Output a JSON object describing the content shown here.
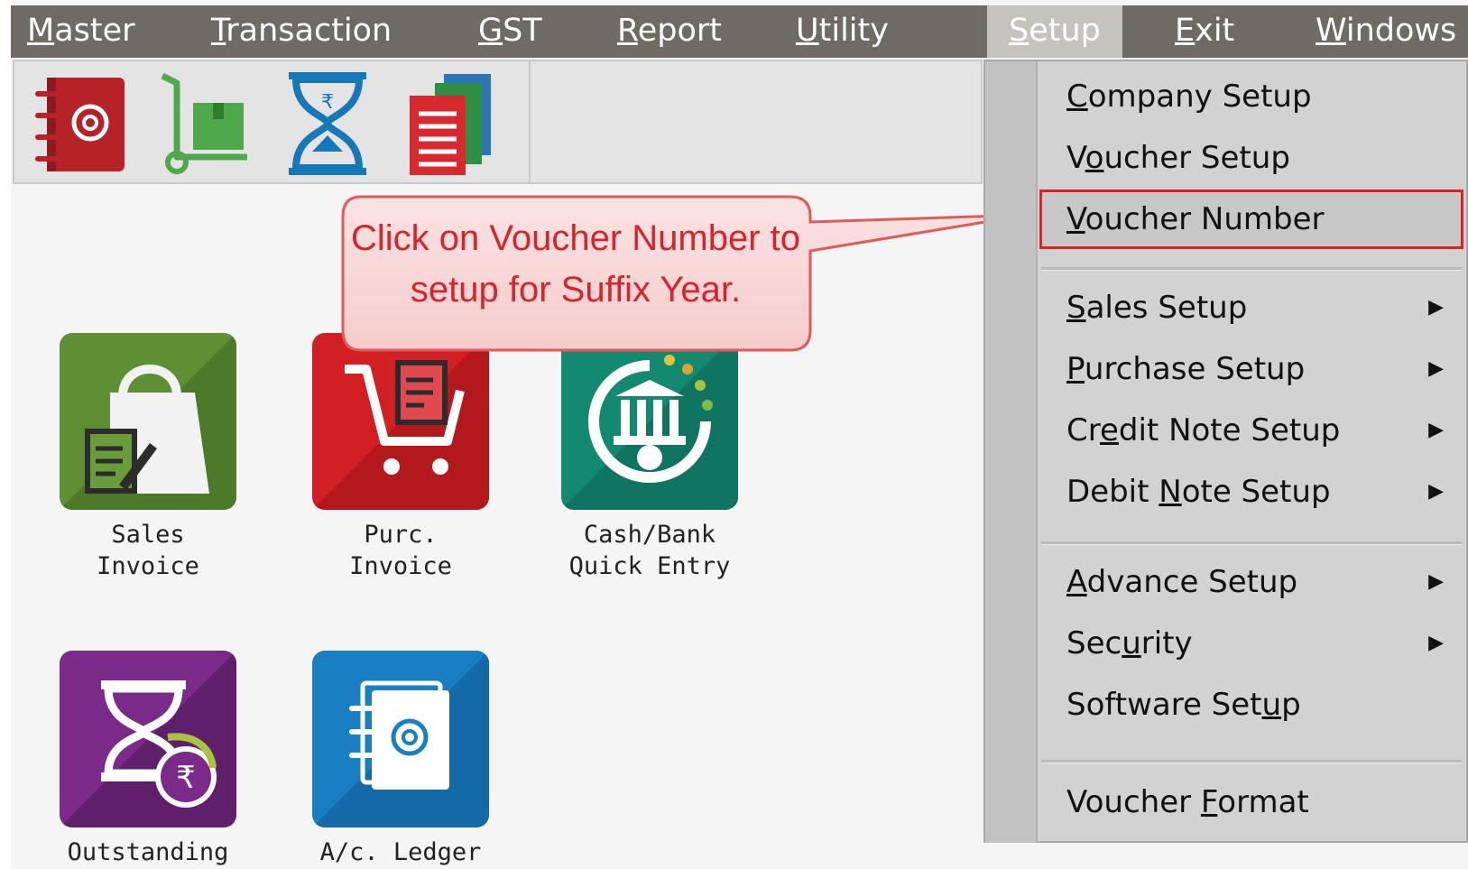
{
  "menubar": {
    "items": [
      {
        "pre": "",
        "mn": "M",
        "post": "aster"
      },
      {
        "pre": "",
        "mn": "T",
        "post": "ransaction"
      },
      {
        "pre": "",
        "mn": "G",
        "post": "ST"
      },
      {
        "pre": "",
        "mn": "R",
        "post": "eport"
      },
      {
        "pre": "",
        "mn": "U",
        "post": "tility"
      },
      {
        "pre": "",
        "mn": "S",
        "post": "etup"
      },
      {
        "pre": "",
        "mn": "E",
        "post": "xit"
      },
      {
        "pre": "",
        "mn": "W",
        "post": "indows"
      }
    ],
    "active_item": "Setup"
  },
  "toolbar": {
    "icons": [
      "address-book-icon",
      "hand-truck-icon",
      "hourglass-rupee-icon",
      "documents-stack-icon"
    ]
  },
  "tiles": [
    {
      "label": "Sales\nInvoice",
      "icon": "shopping-bag-icon",
      "color": "#5f8f34"
    },
    {
      "label": "Purc. Invoice",
      "icon": "shopping-cart-icon",
      "color": "#d21f24"
    },
    {
      "label": "Cash/Bank\nQuick Entry",
      "icon": "bank-icon",
      "color": "#138a70"
    },
    {
      "label": "Outstanding",
      "icon": "hourglass-rupee-icon",
      "color": "#7a2a88"
    },
    {
      "label": "A/c. Ledger",
      "icon": "address-book-icon",
      "color": "#1a7fc2"
    }
  ],
  "callout": {
    "text": "Click on Voucher Number to setup for Suffix Year."
  },
  "dropdown": {
    "items": [
      {
        "pre": "",
        "mn": "C",
        "post": "ompany Setup",
        "submenu": false
      },
      {
        "pre": "V",
        "mn": "o",
        "post": "ucher Setup",
        "submenu": false
      },
      {
        "pre": "",
        "mn": "V",
        "post": "oucher Number",
        "submenu": false,
        "highlighted": true
      },
      {
        "pre": "",
        "mn": "S",
        "post": "ales Setup",
        "submenu": true
      },
      {
        "pre": "",
        "mn": "P",
        "post": "urchase Setup",
        "submenu": true
      },
      {
        "pre": "Cr",
        "mn": "e",
        "post": "dit Note Setup",
        "submenu": true
      },
      {
        "pre": "Debit ",
        "mn": "N",
        "post": "ote Setup",
        "submenu": true
      },
      {
        "pre": "",
        "mn": "A",
        "post": "dvance Setup",
        "submenu": true
      },
      {
        "pre": "Sec",
        "mn": "u",
        "post": "rity",
        "submenu": true
      },
      {
        "pre": "Software Set",
        "mn": "u",
        "post": "p",
        "submenu": false
      },
      {
        "pre": "Voucher ",
        "mn": "F",
        "post": "ormat",
        "submenu": false
      }
    ],
    "submenu_arrow": "▶"
  }
}
